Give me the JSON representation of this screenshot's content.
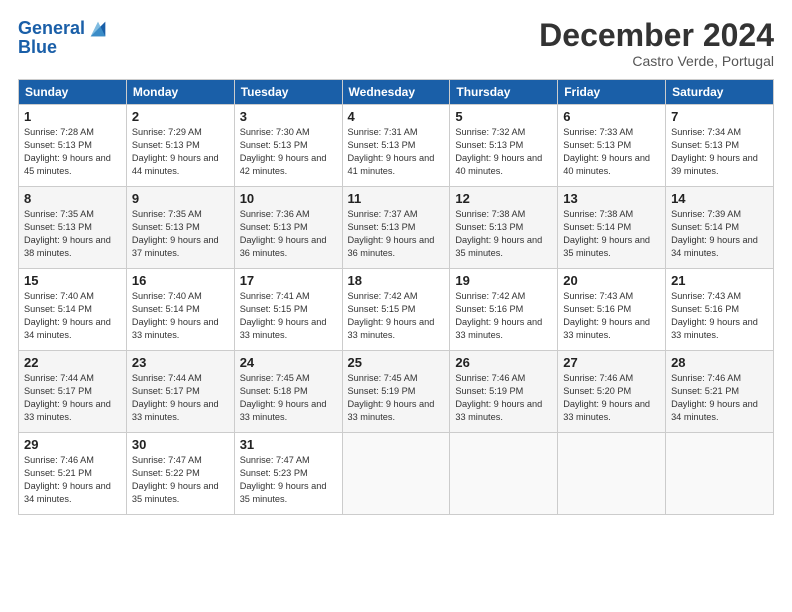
{
  "header": {
    "logo_line1": "General",
    "logo_line2": "Blue",
    "month": "December 2024",
    "location": "Castro Verde, Portugal"
  },
  "weekdays": [
    "Sunday",
    "Monday",
    "Tuesday",
    "Wednesday",
    "Thursday",
    "Friday",
    "Saturday"
  ],
  "weeks": [
    [
      {
        "day": "1",
        "sunrise": "Sunrise: 7:28 AM",
        "sunset": "Sunset: 5:13 PM",
        "daylight": "Daylight: 9 hours and 45 minutes."
      },
      {
        "day": "2",
        "sunrise": "Sunrise: 7:29 AM",
        "sunset": "Sunset: 5:13 PM",
        "daylight": "Daylight: 9 hours and 44 minutes."
      },
      {
        "day": "3",
        "sunrise": "Sunrise: 7:30 AM",
        "sunset": "Sunset: 5:13 PM",
        "daylight": "Daylight: 9 hours and 42 minutes."
      },
      {
        "day": "4",
        "sunrise": "Sunrise: 7:31 AM",
        "sunset": "Sunset: 5:13 PM",
        "daylight": "Daylight: 9 hours and 41 minutes."
      },
      {
        "day": "5",
        "sunrise": "Sunrise: 7:32 AM",
        "sunset": "Sunset: 5:13 PM",
        "daylight": "Daylight: 9 hours and 40 minutes."
      },
      {
        "day": "6",
        "sunrise": "Sunrise: 7:33 AM",
        "sunset": "Sunset: 5:13 PM",
        "daylight": "Daylight: 9 hours and 40 minutes."
      },
      {
        "day": "7",
        "sunrise": "Sunrise: 7:34 AM",
        "sunset": "Sunset: 5:13 PM",
        "daylight": "Daylight: 9 hours and 39 minutes."
      }
    ],
    [
      {
        "day": "8",
        "sunrise": "Sunrise: 7:35 AM",
        "sunset": "Sunset: 5:13 PM",
        "daylight": "Daylight: 9 hours and 38 minutes."
      },
      {
        "day": "9",
        "sunrise": "Sunrise: 7:35 AM",
        "sunset": "Sunset: 5:13 PM",
        "daylight": "Daylight: 9 hours and 37 minutes."
      },
      {
        "day": "10",
        "sunrise": "Sunrise: 7:36 AM",
        "sunset": "Sunset: 5:13 PM",
        "daylight": "Daylight: 9 hours and 36 minutes."
      },
      {
        "day": "11",
        "sunrise": "Sunrise: 7:37 AM",
        "sunset": "Sunset: 5:13 PM",
        "daylight": "Daylight: 9 hours and 36 minutes."
      },
      {
        "day": "12",
        "sunrise": "Sunrise: 7:38 AM",
        "sunset": "Sunset: 5:13 PM",
        "daylight": "Daylight: 9 hours and 35 minutes."
      },
      {
        "day": "13",
        "sunrise": "Sunrise: 7:38 AM",
        "sunset": "Sunset: 5:14 PM",
        "daylight": "Daylight: 9 hours and 35 minutes."
      },
      {
        "day": "14",
        "sunrise": "Sunrise: 7:39 AM",
        "sunset": "Sunset: 5:14 PM",
        "daylight": "Daylight: 9 hours and 34 minutes."
      }
    ],
    [
      {
        "day": "15",
        "sunrise": "Sunrise: 7:40 AM",
        "sunset": "Sunset: 5:14 PM",
        "daylight": "Daylight: 9 hours and 34 minutes."
      },
      {
        "day": "16",
        "sunrise": "Sunrise: 7:40 AM",
        "sunset": "Sunset: 5:14 PM",
        "daylight": "Daylight: 9 hours and 33 minutes."
      },
      {
        "day": "17",
        "sunrise": "Sunrise: 7:41 AM",
        "sunset": "Sunset: 5:15 PM",
        "daylight": "Daylight: 9 hours and 33 minutes."
      },
      {
        "day": "18",
        "sunrise": "Sunrise: 7:42 AM",
        "sunset": "Sunset: 5:15 PM",
        "daylight": "Daylight: 9 hours and 33 minutes."
      },
      {
        "day": "19",
        "sunrise": "Sunrise: 7:42 AM",
        "sunset": "Sunset: 5:16 PM",
        "daylight": "Daylight: 9 hours and 33 minutes."
      },
      {
        "day": "20",
        "sunrise": "Sunrise: 7:43 AM",
        "sunset": "Sunset: 5:16 PM",
        "daylight": "Daylight: 9 hours and 33 minutes."
      },
      {
        "day": "21",
        "sunrise": "Sunrise: 7:43 AM",
        "sunset": "Sunset: 5:16 PM",
        "daylight": "Daylight: 9 hours and 33 minutes."
      }
    ],
    [
      {
        "day": "22",
        "sunrise": "Sunrise: 7:44 AM",
        "sunset": "Sunset: 5:17 PM",
        "daylight": "Daylight: 9 hours and 33 minutes."
      },
      {
        "day": "23",
        "sunrise": "Sunrise: 7:44 AM",
        "sunset": "Sunset: 5:17 PM",
        "daylight": "Daylight: 9 hours and 33 minutes."
      },
      {
        "day": "24",
        "sunrise": "Sunrise: 7:45 AM",
        "sunset": "Sunset: 5:18 PM",
        "daylight": "Daylight: 9 hours and 33 minutes."
      },
      {
        "day": "25",
        "sunrise": "Sunrise: 7:45 AM",
        "sunset": "Sunset: 5:19 PM",
        "daylight": "Daylight: 9 hours and 33 minutes."
      },
      {
        "day": "26",
        "sunrise": "Sunrise: 7:46 AM",
        "sunset": "Sunset: 5:19 PM",
        "daylight": "Daylight: 9 hours and 33 minutes."
      },
      {
        "day": "27",
        "sunrise": "Sunrise: 7:46 AM",
        "sunset": "Sunset: 5:20 PM",
        "daylight": "Daylight: 9 hours and 33 minutes."
      },
      {
        "day": "28",
        "sunrise": "Sunrise: 7:46 AM",
        "sunset": "Sunset: 5:21 PM",
        "daylight": "Daylight: 9 hours and 34 minutes."
      }
    ],
    [
      {
        "day": "29",
        "sunrise": "Sunrise: 7:46 AM",
        "sunset": "Sunset: 5:21 PM",
        "daylight": "Daylight: 9 hours and 34 minutes."
      },
      {
        "day": "30",
        "sunrise": "Sunrise: 7:47 AM",
        "sunset": "Sunset: 5:22 PM",
        "daylight": "Daylight: 9 hours and 35 minutes."
      },
      {
        "day": "31",
        "sunrise": "Sunrise: 7:47 AM",
        "sunset": "Sunset: 5:23 PM",
        "daylight": "Daylight: 9 hours and 35 minutes."
      },
      null,
      null,
      null,
      null
    ]
  ]
}
